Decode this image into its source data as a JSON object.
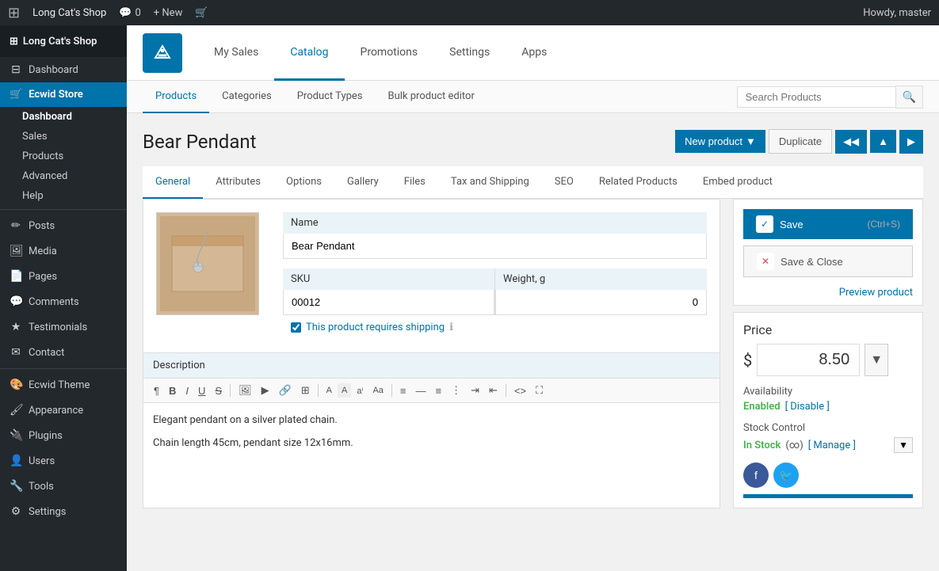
{
  "adminbar": {
    "site_name": "Long Cat's Shop",
    "comment_count": "0",
    "new_label": "+ New",
    "howdy": "Howdy, master",
    "wp_icon": "⊞"
  },
  "sidebar": {
    "store_name": "Long Cat's Shop",
    "items": [
      {
        "id": "dashboard",
        "label": "Dashboard",
        "icon": "⊟",
        "active": true
      },
      {
        "id": "ecwid-store",
        "label": "Ecwid Store",
        "icon": "🛒",
        "highlighted": true
      },
      {
        "id": "dashboard-sub",
        "label": "Dashboard",
        "sub": true,
        "active": true
      },
      {
        "id": "sales-sub",
        "label": "Sales",
        "sub": true
      },
      {
        "id": "products-sub",
        "label": "Products",
        "sub": true
      },
      {
        "id": "advanced-sub",
        "label": "Advanced",
        "sub": true
      },
      {
        "id": "help-sub",
        "label": "Help",
        "sub": true
      },
      {
        "id": "posts",
        "label": "Posts",
        "icon": "✏"
      },
      {
        "id": "media",
        "label": "Media",
        "icon": "🖼"
      },
      {
        "id": "pages",
        "label": "Pages",
        "icon": "📄"
      },
      {
        "id": "comments",
        "label": "Comments",
        "icon": "💬"
      },
      {
        "id": "testimonials",
        "label": "Testimonials",
        "icon": "★"
      },
      {
        "id": "contact",
        "label": "Contact",
        "icon": "✉"
      },
      {
        "id": "ecwid-theme",
        "label": "Ecwid Theme",
        "icon": "🎨"
      },
      {
        "id": "appearance",
        "label": "Appearance",
        "icon": "🖌"
      },
      {
        "id": "plugins",
        "label": "Plugins",
        "icon": "🔌"
      },
      {
        "id": "users",
        "label": "Users",
        "icon": "👤"
      },
      {
        "id": "tools",
        "label": "Tools",
        "icon": "🔧"
      },
      {
        "id": "settings",
        "label": "Settings",
        "icon": "⚙"
      }
    ]
  },
  "ecwid_nav": {
    "logo_alt": "Ecwid",
    "items": [
      {
        "id": "my-sales",
        "label": "My Sales",
        "active": false
      },
      {
        "id": "catalog",
        "label": "Catalog",
        "active": true
      },
      {
        "id": "promotions",
        "label": "Promotions",
        "active": false
      },
      {
        "id": "settings",
        "label": "Settings",
        "active": false
      },
      {
        "id": "apps",
        "label": "Apps",
        "active": false
      }
    ]
  },
  "sub_nav": {
    "tabs": [
      {
        "id": "products",
        "label": "Products",
        "active": true
      },
      {
        "id": "categories",
        "label": "Categories",
        "active": false
      },
      {
        "id": "product-types",
        "label": "Product Types",
        "active": false
      },
      {
        "id": "bulk-editor",
        "label": "Bulk product editor",
        "active": false
      }
    ],
    "search_placeholder": "Search Products"
  },
  "product": {
    "title": "Bear Pendant",
    "actions": {
      "new_product": "New product",
      "duplicate": "Duplicate"
    },
    "tabs": [
      {
        "id": "general",
        "label": "General",
        "active": true
      },
      {
        "id": "attributes",
        "label": "Attributes",
        "active": false
      },
      {
        "id": "options",
        "label": "Options",
        "active": false
      },
      {
        "id": "gallery",
        "label": "Gallery",
        "active": false
      },
      {
        "id": "files",
        "label": "Files",
        "active": false
      },
      {
        "id": "tax-shipping",
        "label": "Tax and Shipping",
        "active": false
      },
      {
        "id": "seo",
        "label": "SEO",
        "active": false
      },
      {
        "id": "related-products",
        "label": "Related Products",
        "active": false
      },
      {
        "id": "embed-product",
        "label": "Embed product",
        "active": false
      }
    ],
    "name_label": "Name",
    "name_value": "Bear Pendant",
    "sku_label": "SKU",
    "sku_value": "00012",
    "weight_label": "Weight, g",
    "weight_value": "0",
    "shipping_label": "This product requires shipping",
    "description_label": "Description",
    "description_text1": "Elegant pendant on a silver plated chain.",
    "description_text2": "Chain length 45cm, pendant size 12x16mm."
  },
  "sidebar_panel": {
    "save_label": "Save",
    "save_shortcut": "(Ctrl+S)",
    "save_close_label": "Save & Close",
    "preview_label": "Preview product",
    "price_label": "Price",
    "currency_symbol": "$",
    "price_value": "8.50",
    "availability_label": "Availability",
    "availability_status": "Enabled",
    "disable_label": "[ Disable ]",
    "stock_label": "Stock Control",
    "stock_status": "In Stock",
    "stock_inf": "(∞)",
    "manage_label": "[ Manage ]"
  },
  "colors": {
    "accent": "#0073aa",
    "enabled": "#46b450",
    "facebook": "#3b5998",
    "twitter": "#1da1f2"
  }
}
